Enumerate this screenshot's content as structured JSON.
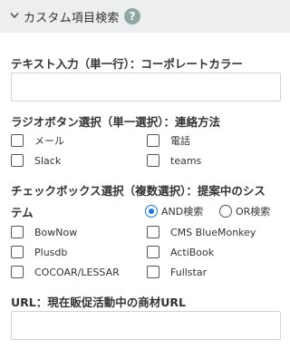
{
  "header": {
    "title": "カスタム項目検索",
    "help_icon": "?"
  },
  "field1": {
    "label": "テキスト入力（単一行）：コーポレートカラー",
    "value": ""
  },
  "field2": {
    "label": "ラジオボタン選択（単一選択）：連絡方法",
    "options": [
      "メール",
      "電話",
      "Slack",
      "teams"
    ]
  },
  "field3": {
    "label_line1": "チェックボックス選択（複数選択）：提案中のシス",
    "label_line2": "テム",
    "mode_options": [
      "AND検索",
      "OR検索"
    ],
    "mode_selected": "AND検索",
    "options": [
      "BowNow",
      "CMS BlueMonkey",
      "Plusdb",
      "ActiBook",
      "COCOAR/LESSAR",
      "Fullstar"
    ]
  },
  "field4": {
    "label": "URL：現在販促活動中の商材URL",
    "value": ""
  }
}
